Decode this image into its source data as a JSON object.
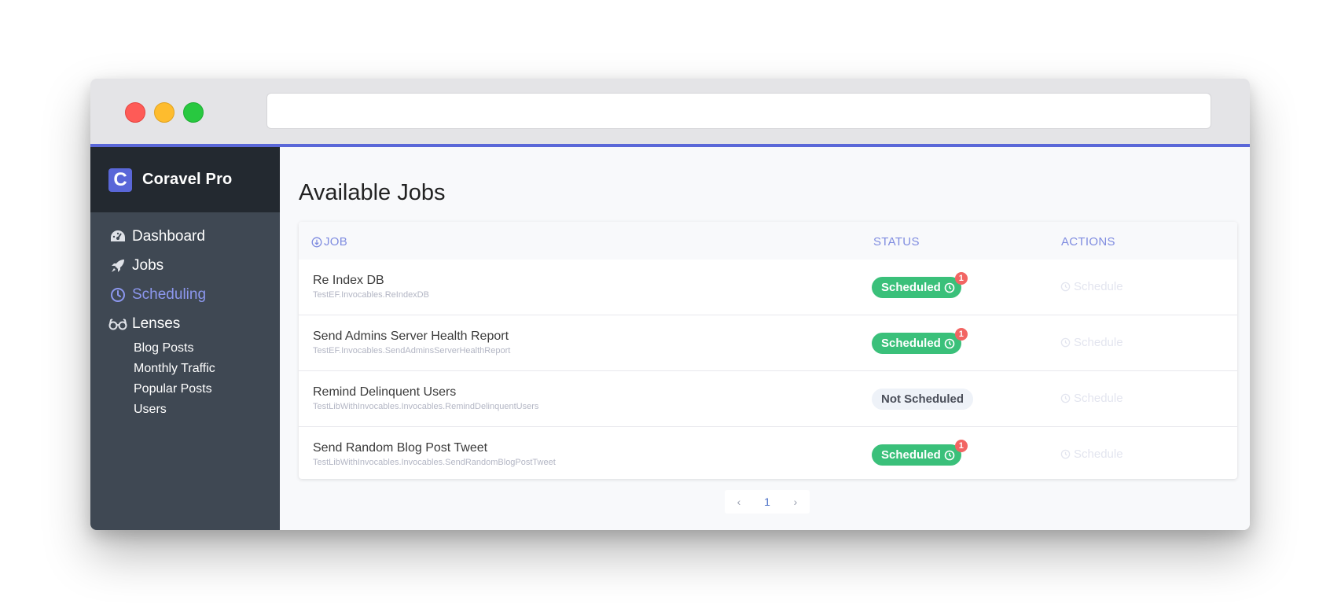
{
  "app": {
    "name": "Coravel Pro",
    "logo_letter": "C"
  },
  "browser": {
    "url": ""
  },
  "sidebar": {
    "items": [
      {
        "label": "Dashboard",
        "icon": "dashboard-gauge-icon"
      },
      {
        "label": "Jobs",
        "icon": "rocket-icon"
      },
      {
        "label": "Scheduling",
        "icon": "clock-icon",
        "active": true
      },
      {
        "label": "Lenses",
        "icon": "glasses-icon"
      }
    ],
    "lenses": [
      "Blog Posts",
      "Monthly Traffic",
      "Popular Posts",
      "Users"
    ]
  },
  "main": {
    "title": "Available Jobs",
    "columns": {
      "job": "JOB",
      "status": "STATUS",
      "actions": "ACTIONS"
    },
    "rows": [
      {
        "name": "Re Index DB",
        "class": "TestEF.Invocables.ReIndexDB",
        "status": "Scheduled",
        "count": "1",
        "action": "Schedule"
      },
      {
        "name": "Send Admins Server Health Report",
        "class": "TestEF.Invocables.SendAdminsServerHealthReport",
        "status": "Scheduled",
        "count": "1",
        "action": "Schedule"
      },
      {
        "name": "Remind Delinquent Users",
        "class": "TestLibWithInvocables.Invocables.RemindDelinquentUsers",
        "status": "Not Scheduled",
        "count": "",
        "action": "Schedule"
      },
      {
        "name": "Send Random Blog Post Tweet",
        "class": "TestLibWithInvocables.Invocables.SendRandomBlogPostTweet",
        "status": "Scheduled",
        "count": "1",
        "action": "Schedule"
      }
    ],
    "pagination": {
      "prev": "‹",
      "current": "1",
      "next": "›"
    }
  },
  "colors": {
    "accent": "#5a67d8",
    "scheduled": "#3ac07a",
    "notification": "#f26563",
    "sidebar": "#3f4853"
  }
}
